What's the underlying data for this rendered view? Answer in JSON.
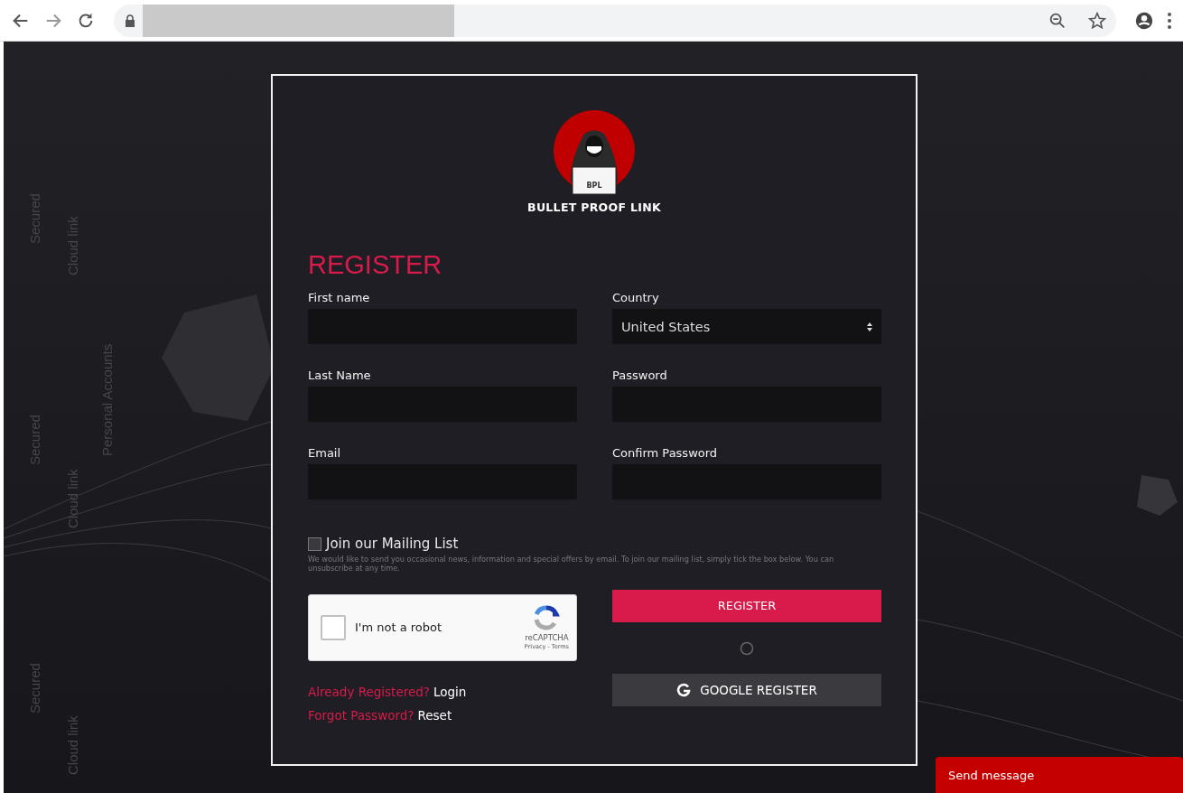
{
  "background_texts": [
    {
      "text": "Secured"
    },
    {
      "text": "Cloud link"
    },
    {
      "text": "Personal Accounts"
    },
    {
      "text": "Secured"
    },
    {
      "text": "Cloud link"
    },
    {
      "text": "Secured"
    },
    {
      "text": "Cloud link"
    }
  ],
  "logo": {
    "badge": "BPL",
    "name": "BULLET PROOF LINK"
  },
  "title": "REGISTER",
  "fields": [
    {
      "label": "First name",
      "kind": "text"
    },
    {
      "label": "Country",
      "kind": "select",
      "value": "United States"
    },
    {
      "label": "Last Name",
      "kind": "text"
    },
    {
      "label": "Password",
      "kind": "password"
    },
    {
      "label": "Email",
      "kind": "text"
    },
    {
      "label": "Confirm Password",
      "kind": "password"
    }
  ],
  "mailing": {
    "label": "Join our Mailing List",
    "checked": false,
    "note": "We would like to send you occasional news, information and special offers by email. To join our mailing list, simply tick the box below. You can unsubscribe at any time."
  },
  "captcha": {
    "label": "I'm not a robot",
    "checked": false,
    "brand": "reCAPTCHA",
    "terms": "Privacy - Terms"
  },
  "register_button": "REGISTER",
  "google_button": "GOOGLE REGISTER",
  "links": [
    {
      "prompt": "Already Registered?",
      "action": "Login"
    },
    {
      "prompt": "Forgot Password?",
      "action": "Reset"
    }
  ],
  "send_message": "Send message"
}
